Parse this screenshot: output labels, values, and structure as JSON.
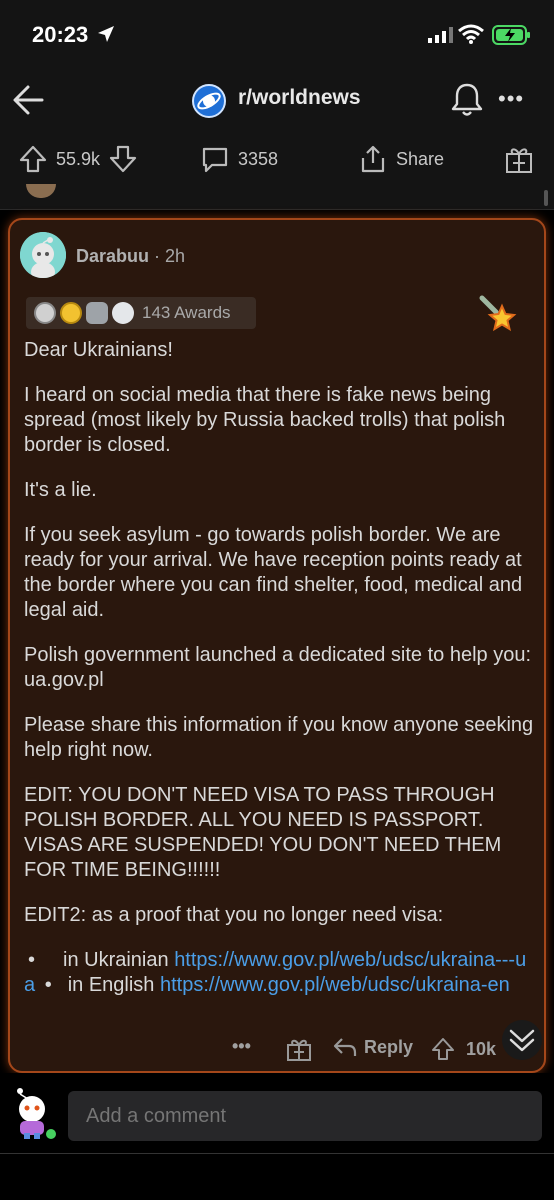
{
  "status": {
    "time": "20:23"
  },
  "nav": {
    "subreddit": "r/worldnews"
  },
  "post_actions": {
    "upvotes": "55.9k",
    "comments": "3358",
    "share_label": "Share"
  },
  "comment": {
    "author": "Darabuu",
    "age": "2h",
    "awards_count": "143 Awards",
    "paragraphs": {
      "p1": "Dear Ukrainians!",
      "p2": "I heard on social media that there is fake news being spread (most likely by Russia backed trolls) that polish border is closed.",
      "p3": "It's a lie.",
      "p4": "If you seek asylum - go towards polish border. We are ready for your arrival. We have reception points ready at the border where you can find shelter, food, medical and legal aid.",
      "p5": "Polish government launched a dedicated site to help you: ua.gov.pl",
      "p6": "Please share this information if you know anyone seeking help right now.",
      "p7": "EDIT: YOU DON'T NEED VISA TO PASS THROUGH POLISH BORDER. ALL YOU NEED IS PASSPORT. VISAS ARE SUSPENDED! YOU DON'T NEED THEM FOR TIME BEING!!!!!!",
      "p8": "EDIT2: as a proof that you no longer need visa:"
    },
    "links": {
      "bullet": "•",
      "ua_label": "in Ukrainian",
      "ua_url": "https://www.gov.pl/web/udsc/ukraina---ua",
      "en_label": "in English",
      "en_url": "https://www.gov.pl/web/udsc/ukraina-en"
    },
    "actions": {
      "more": "•••",
      "reply_label": "Reply",
      "score": "10k"
    }
  },
  "composer": {
    "placeholder": "Add a comment"
  },
  "colors": {
    "accent_border": "#a4471a",
    "card_bg": "#2a170d",
    "link": "#4b9ee7",
    "online": "#46d160"
  }
}
